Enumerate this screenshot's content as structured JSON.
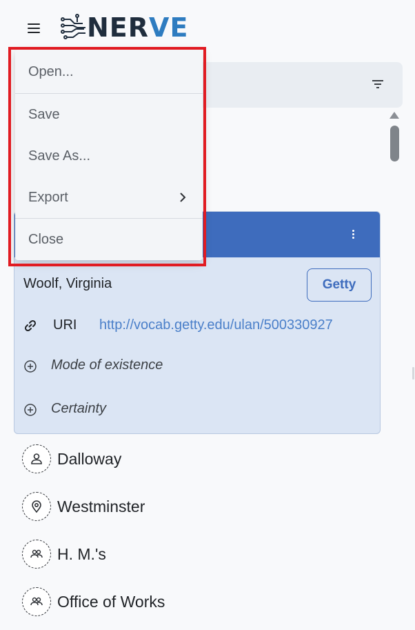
{
  "app": {
    "logo_prefix": "NER",
    "logo_suffix": "VE"
  },
  "file_menu": {
    "open": "Open...",
    "save": "Save",
    "save_as": "Save As...",
    "export": "Export",
    "close": "Close"
  },
  "card": {
    "entity_name": "Woolf, Virginia",
    "source_button": "Getty",
    "uri_label": "URI",
    "uri_value": "http://vocab.getty.edu/ulan/500330927",
    "mode_of_existence": "Mode of existence",
    "certainty": "Certainty"
  },
  "entities": [
    {
      "label": "Dalloway",
      "icon": "person-icon"
    },
    {
      "label": "Westminster",
      "icon": "location-pin-icon"
    },
    {
      "label": "H. M.'s",
      "icon": "group-icon"
    },
    {
      "label": "Office of Works",
      "icon": "group-icon"
    }
  ],
  "colors": {
    "accent": "#3e6cbd",
    "card_bg": "#dbe5f4",
    "link": "#4a7fc9",
    "highlight": "#e11b22",
    "logo_dark": "#1f2d3d",
    "logo_blue": "#2e7cc0"
  }
}
